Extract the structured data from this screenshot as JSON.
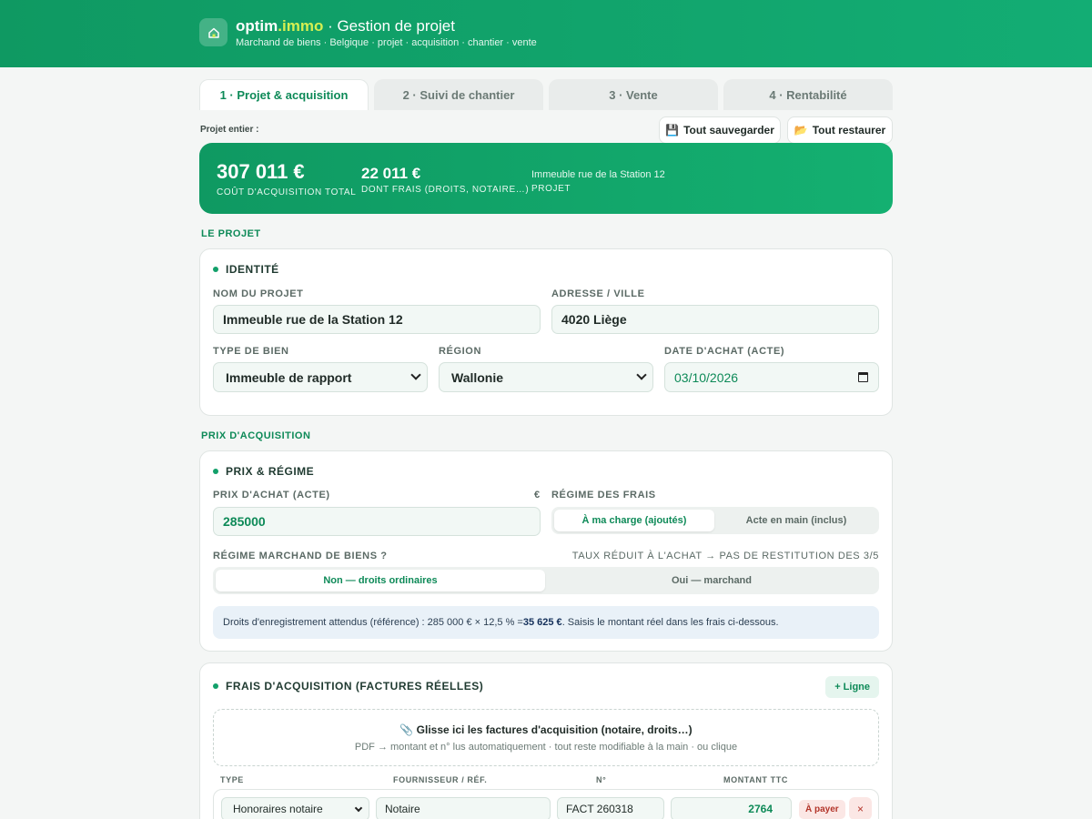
{
  "header": {
    "brand_main": "optim",
    "brand_accent": ".immo",
    "brand_rest": " · Gestion de projet",
    "tagline": "Marchand de biens · Belgique · projet · acquisition · chantier · vente",
    "logo_icon": "house-icon"
  },
  "tabs": [
    {
      "label": "1 · Projet & acquisition",
      "active": true
    },
    {
      "label": "2 · Suivi de chantier",
      "active": false
    },
    {
      "label": "3 · Vente",
      "active": false
    },
    {
      "label": "4 · Rentabilité",
      "active": false
    }
  ],
  "toolbar": {
    "project_label": "Projet entier :",
    "save_label": "Tout sauvegarder",
    "save_icon": "💾",
    "restore_label": "Tout restaurer",
    "restore_icon": "📂"
  },
  "summary": {
    "total_value": "307 011 €",
    "total_label": "COÛT D'ACQUISITION TOTAL",
    "fees_value": "22 011 €",
    "fees_label": "DONT FRAIS (DROITS, NOTAIRE…)",
    "project_name": "Immeuble rue de la Station 12",
    "project_label": "PROJET"
  },
  "section_projet": "LE PROJET",
  "identity": {
    "title": "IDENTITÉ",
    "name_label": "NOM DU PROJET",
    "name_value": "Immeuble rue de la Station 12",
    "address_label": "ADRESSE / VILLE",
    "address_value": "4020 Liège",
    "type_label": "TYPE DE BIEN",
    "type_value": "Immeuble de rapport",
    "region_label": "RÉGION",
    "region_value": "Wallonie",
    "date_label": "DATE D'ACHAT (ACTE)",
    "date_value": "03/10/2026"
  },
  "section_prix": "PRIX D'ACQUISITION",
  "price": {
    "title": "PRIX & RÉGIME",
    "price_label": "PRIX D'ACHAT (ACTE)",
    "currency": "€",
    "price_value": "285000",
    "regime_label": "RÉGIME DES FRAIS",
    "regime_options": [
      "À ma charge (ajoutés)",
      "Acte en main (inclus)"
    ],
    "marchand_label": "RÉGIME MARCHAND DE BIENS ?",
    "marchand_hint": "TAUX RÉDUIT À L'ACHAT → PAS DE RESTITUTION DES 3/5",
    "marchand_options": [
      "Non — droits ordinaires",
      "Oui — marchand"
    ],
    "info_prefix": "Droits d'enregistrement attendus (référence) : 285 000 € × 12,5 % = ",
    "info_amount": "35 625 €",
    "info_suffix": ". Saisis le montant réel dans les frais ci-dessous."
  },
  "fees": {
    "title": "FRAIS D'ACQUISITION (FACTURES RÉELLES)",
    "add_label": "+ Ligne",
    "drop_icon": "📎",
    "drop_title": "Glisse ici les factures d'acquisition (notaire, droits…)",
    "drop_sub": "PDF → montant et n° lus automatiquement · tout reste modifiable à la main · ou clique",
    "columns": [
      "TYPE",
      "FOURNISSEUR / RÉF.",
      "N°",
      "MONTANT TTC"
    ],
    "rows": [
      {
        "type": "Honoraires notaire",
        "supplier": "Notaire",
        "number": "FACT 260318",
        "amount": "2764",
        "status": "À payer",
        "delete": "×"
      }
    ]
  }
}
